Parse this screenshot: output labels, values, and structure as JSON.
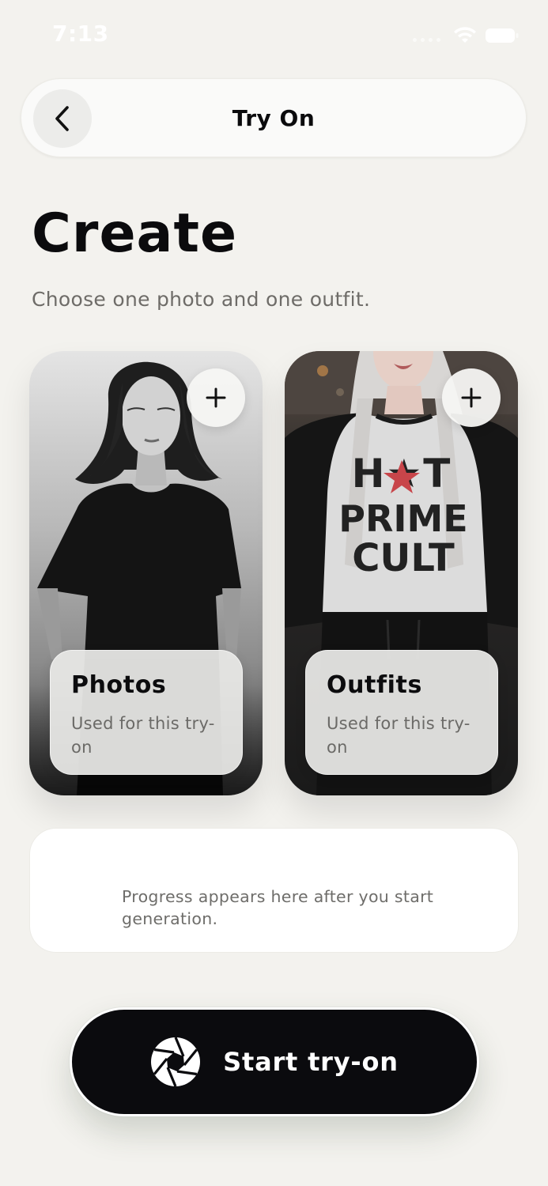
{
  "status_bar": {
    "time": "7:13"
  },
  "header": {
    "title": "Try On"
  },
  "main": {
    "title": "Create",
    "subtitle": "Choose one photo and one outfit."
  },
  "cards": {
    "photos": {
      "title": "Photos",
      "subtitle": "Used for this try-on"
    },
    "outfits": {
      "title": "Outfits",
      "subtitle": "Used for this try-on",
      "shirt_text": [
        "H★T",
        "PRIME",
        "CULT"
      ]
    }
  },
  "progress": {
    "text": "Progress appears here after you start generation."
  },
  "cta": {
    "label": "Start try-on"
  },
  "colors": {
    "background": "#f3f2ee",
    "primary": "#0b0b0e",
    "accent_star": "#c8454a"
  },
  "icons": {
    "back": "chevron-left-icon",
    "add": "plus-icon",
    "cta": "aperture-icon",
    "wifi": "wifi-icon",
    "battery": "battery-icon"
  }
}
